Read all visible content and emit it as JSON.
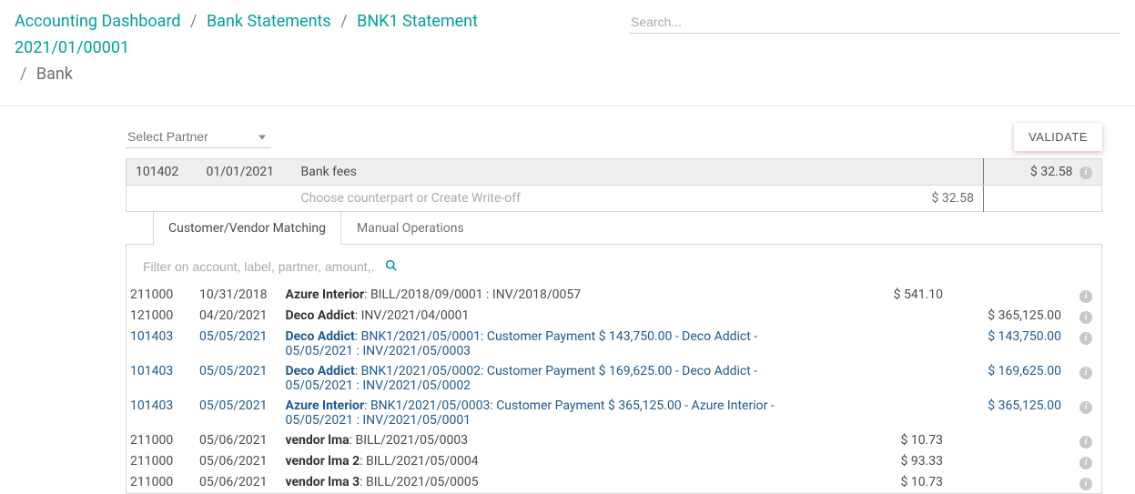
{
  "breadcrumb": {
    "items": [
      "Accounting Dashboard",
      "Bank Statements",
      "BNK1 Statement 2021/01/00001"
    ],
    "current": "Bank",
    "sep": "/"
  },
  "search": {
    "placeholder": "Search..."
  },
  "partner": {
    "placeholder": "Select Partner"
  },
  "validate_label": "VALIDATE",
  "stline": {
    "account": "101402",
    "date": "01/01/2021",
    "label": "Bank fees",
    "amount": "$ 32.58",
    "counterpart_hint": "Choose counterpart or Create Write-off",
    "counterpart_amount": "$ 32.58"
  },
  "tabs": {
    "matching": "Customer/Vendor Matching",
    "manual": "Manual Operations"
  },
  "filter": {
    "placeholder": "Filter on account, label, partner, amount,.."
  },
  "icons": {
    "info": "i"
  },
  "rows": [
    {
      "acc": "211000",
      "date": "10/31/2018",
      "partner": "Azure Interior",
      "rest": ": BILL/2018/09/0001 : INV/2018/0057",
      "amt_col1": "$ 541.10",
      "amt_col2": "",
      "link": false
    },
    {
      "acc": "121000",
      "date": "04/20/2021",
      "partner": "Deco Addict",
      "rest": ": INV/2021/04/0001",
      "amt_col1": "",
      "amt_col2": "$ 365,125.00",
      "link": false
    },
    {
      "acc": "101403",
      "date": "05/05/2021",
      "partner": "Deco Addict",
      "rest": ": BNK1/2021/05/0001: Customer Payment $ 143,750.00 - Deco Addict - 05/05/2021 : INV/2021/05/0003",
      "amt_col1": "",
      "amt_col2": "$ 143,750.00",
      "link": true
    },
    {
      "acc": "101403",
      "date": "05/05/2021",
      "partner": "Deco Addict",
      "rest": ": BNK1/2021/05/0002: Customer Payment $ 169,625.00 - Deco Addict - 05/05/2021 : INV/2021/05/0002",
      "amt_col1": "",
      "amt_col2": "$ 169,625.00",
      "link": true
    },
    {
      "acc": "101403",
      "date": "05/05/2021",
      "partner": "Azure Interior",
      "rest": ": BNK1/2021/05/0003: Customer Payment $ 365,125.00 - Azure Interior - 05/05/2021 : INV/2021/05/0001",
      "amt_col1": "",
      "amt_col2": "$ 365,125.00",
      "link": true
    },
    {
      "acc": "211000",
      "date": "05/06/2021",
      "partner": "vendor lma",
      "rest": ": BILL/2021/05/0003",
      "amt_col1": "$ 10.73",
      "amt_col2": "",
      "link": false
    },
    {
      "acc": "211000",
      "date": "05/06/2021",
      "partner": "vendor lma 2",
      "rest": ": BILL/2021/05/0004",
      "amt_col1": "$ 93.33",
      "amt_col2": "",
      "link": false
    },
    {
      "acc": "211000",
      "date": "05/06/2021",
      "partner": "vendor lma 3",
      "rest": ": BILL/2021/05/0005",
      "amt_col1": "$ 10.73",
      "amt_col2": "",
      "link": false
    }
  ]
}
